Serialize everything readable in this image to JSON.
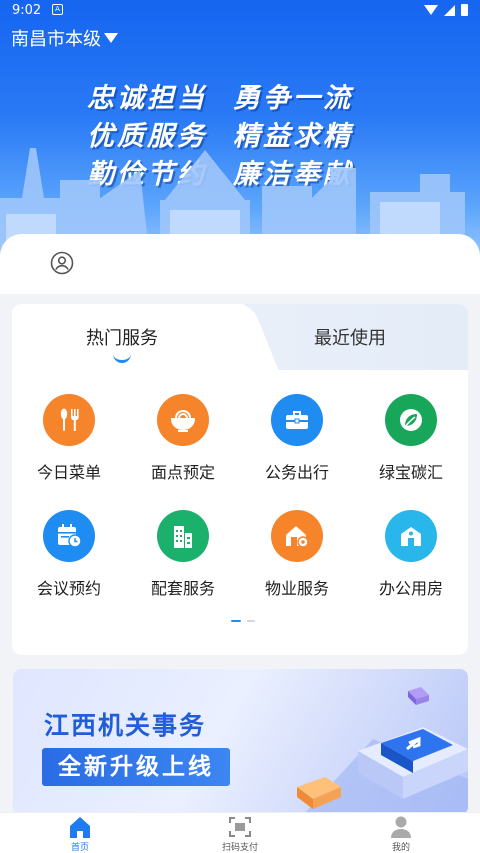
{
  "status_bar": {
    "time": "9:02"
  },
  "header": {
    "city": "南昌市本级"
  },
  "hero": {
    "slogan_lines": [
      [
        "忠诚担当",
        "勇争一流"
      ],
      [
        "优质服务",
        "精益求精"
      ],
      [
        "勤俭节约",
        "廉洁奉献"
      ]
    ]
  },
  "service_tabs": {
    "active": "热门服务",
    "other": "最近使用"
  },
  "services": [
    {
      "label": "今日菜单",
      "icon": "fork-knife-icon",
      "color": "#f5842b"
    },
    {
      "label": "面点预定",
      "icon": "noodle-bowl-icon",
      "color": "#f5842b"
    },
    {
      "label": "公务出行",
      "icon": "briefcase-icon",
      "color": "#1e8cf0"
    },
    {
      "label": "绿宝碳汇",
      "icon": "leaf-icon",
      "color": "#18a65a"
    },
    {
      "label": "会议预约",
      "icon": "calendar-clock-icon",
      "color": "#1e8cf0"
    },
    {
      "label": "配套服务",
      "icon": "buildings-icon",
      "color": "#1bb06c"
    },
    {
      "label": "物业服务",
      "icon": "house-gear-icon",
      "color": "#f5842b"
    },
    {
      "label": "办公用房",
      "icon": "office-house-icon",
      "color": "#29b6ea"
    }
  ],
  "banner": {
    "title": "江西机关事务",
    "subtitle": "全新升级上线"
  },
  "bottom_nav": [
    {
      "label": "首页",
      "icon": "home-icon",
      "active": true
    },
    {
      "label": "扫码支付",
      "icon": "scan-icon",
      "active": false
    },
    {
      "label": "我的",
      "icon": "profile-icon",
      "active": false
    }
  ]
}
